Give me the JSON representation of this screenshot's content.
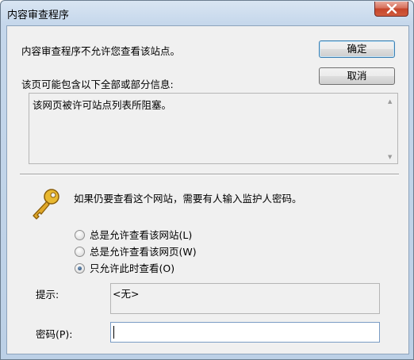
{
  "window": {
    "title": "内容审查程序"
  },
  "message": "内容审查程序不允许您查看该站点。",
  "buttons": {
    "ok_label": "确定",
    "cancel_label": "取消"
  },
  "info": {
    "label": "该页可能包含以下全部或部分信息:",
    "text": "该网页被许可站点列表所阻塞。"
  },
  "password_section": {
    "prompt": "如果仍要查看这个网站，需要有人输入监护人密码。",
    "options": [
      {
        "label": "总是允许查看该网站(L)",
        "checked": false
      },
      {
        "label": "总是允许查看该网页(W)",
        "checked": false
      },
      {
        "label": "只允许此时查看(O)",
        "checked": true
      }
    ],
    "hint_label": "提示:",
    "hint_value": "<无>",
    "password_label": "密码(P):",
    "password_value": ""
  },
  "icons": {
    "close": "close-icon",
    "key": "key-icon",
    "scroll_up": "scroll-up-arrow-icon",
    "scroll_down": "scroll-down-arrow-icon"
  },
  "colors": {
    "close_button": "#c5452a",
    "key": "#d9a520",
    "dialog_bg": "#f0f0f0"
  }
}
